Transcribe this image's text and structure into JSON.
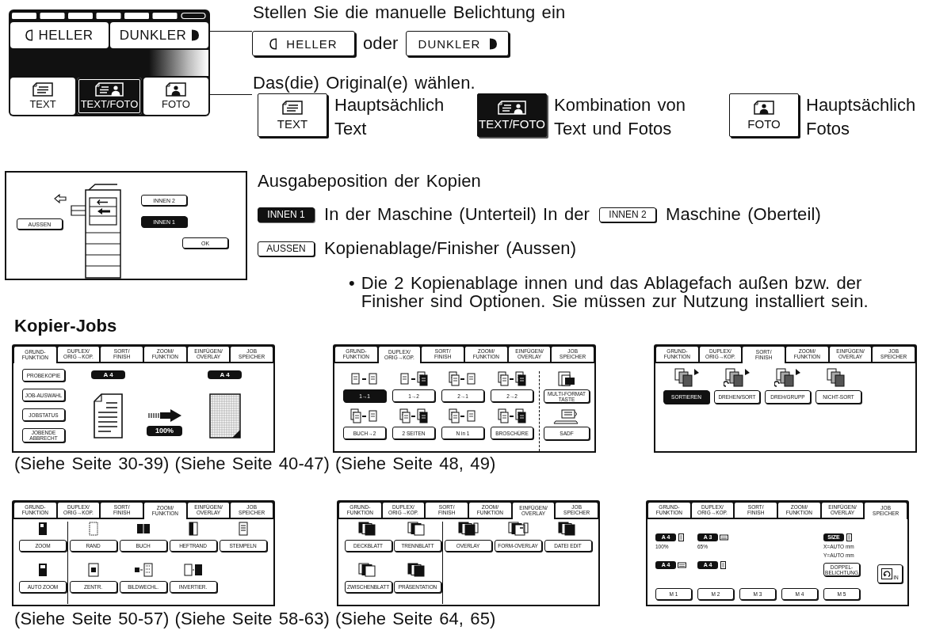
{
  "exposure_panel": {
    "exposure_buttons": [
      {
        "label": "HELLER",
        "kind": "lighter"
      },
      {
        "label": "DUNKLER",
        "kind": "darker"
      }
    ],
    "original_buttons": [
      {
        "label": "TEXT",
        "kind": "text",
        "selected": false
      },
      {
        "label": "TEXT/FOTO",
        "kind": "text_photo",
        "selected": true
      },
      {
        "label": "FOTO",
        "kind": "photo",
        "selected": false
      }
    ]
  },
  "exposure_help": {
    "heading": "Stellen Sie die manuelle Belichtung ein",
    "buttons": [
      {
        "label": "HELLER",
        "kind": "lighter"
      },
      {
        "label": "DUNKLER",
        "kind": "darker"
      }
    ],
    "conjunction": "oder"
  },
  "original_help": {
    "heading": "Das(die) Original(e) wählen.",
    "options": [
      {
        "label": "TEXT",
        "kind": "text",
        "selected": false,
        "description": "Hauptsächlich\nText"
      },
      {
        "label": "TEXT/FOTO",
        "kind": "text_photo",
        "selected": true,
        "description": "Kombination von\nText und Fotos"
      },
      {
        "label": "FOTO",
        "kind": "photo",
        "selected": false,
        "description": "Hauptsächlich\nFotos"
      }
    ]
  },
  "output_panel": {
    "trays": [
      {
        "label": "AUSSEN",
        "kind": "outer",
        "selected": false
      },
      {
        "label": "INNEN 2",
        "kind": "inner",
        "selected": false
      },
      {
        "label": "INNEN 1",
        "kind": "inner",
        "selected": true
      }
    ],
    "ok_button": "OK"
  },
  "output_help": {
    "heading": "Ausgabeposition der Kopien",
    "rows": [
      {
        "button": {
          "label": "INNEN 1",
          "selected": true
        },
        "text": "In der Maschine (Unterteil) In der",
        "inline_button": {
          "label": "INNEN 2",
          "selected": false
        },
        "text_after": "Maschine (Oberteil)"
      },
      {
        "button": {
          "label": "AUSSEN",
          "selected": false
        },
        "text": "Kopienablage/Finisher (Aussen)"
      }
    ],
    "bullet": "•",
    "note": "Die 2 Kopienablage innen und das Ablagefach außen bzw. der\nFinisher sind Optionen. Sie müssen zur Nutzung installiert sein."
  },
  "section_title": "Kopier-Jobs",
  "job_rows": [
    {
      "screens": [
        {
          "kind": "basic",
          "tabs": [
            {
              "label": "GRUND-\nFUNKTION",
              "selected": true
            },
            {
              "label": "DUPLEX/\nORIG→KOP.",
              "selected": false
            },
            {
              "label": "SORT/\nFINISH",
              "selected": false
            },
            {
              "label": "ZOOM/\nFUNKTION",
              "selected": false
            },
            {
              "label": "EINFÜGEN/\nOVERLAY",
              "selected": false
            },
            {
              "label": "JOB\nSPEICHER",
              "selected": false
            }
          ],
          "side_buttons": [
            "PROBEKOPIE",
            "JOB-AUSWAHL",
            "JOBSTATUS",
            "JOBENDE\nABBRECHT"
          ],
          "original_size": "A 4",
          "copy_size": "A 4",
          "ratio": "100%"
        },
        {
          "kind": "duplex",
          "tabs": [
            {
              "label": "GRUND-\nFUNKTION",
              "selected": false
            },
            {
              "label": "DUPLEX/\nORIG→KOP.",
              "selected": true
            },
            {
              "label": "SORT/\nFINISH",
              "selected": false
            },
            {
              "label": "ZOOM/\nFUNKTION",
              "selected": false
            },
            {
              "label": "EINFÜGEN/\nOVERLAY",
              "selected": false
            },
            {
              "label": "JOB\nSPEICHER",
              "selected": false
            }
          ],
          "rows": [
            {
              "buttons": [
                {
                  "label": "1→1",
                  "selected": true
                },
                {
                  "label": "1→2",
                  "selected": false
                },
                {
                  "label": "2→1",
                  "selected": false
                },
                {
                  "label": "2→2",
                  "selected": false
                }
              ]
            },
            {
              "buttons": [
                {
                  "label": "BUCH→2",
                  "selected": false
                },
                {
                  "label": "2 SEITEN",
                  "selected": false
                },
                {
                  "label": "N in 1",
                  "selected": false
                },
                {
                  "label": "BROSCHÜRE",
                  "selected": false
                }
              ]
            }
          ],
          "extras": [
            "MULTI-FORMAT\nTASTE",
            "SADF"
          ]
        },
        {
          "kind": "sort",
          "tabs": [
            {
              "label": "GRUND-\nFUNKTION",
              "selected": false
            },
            {
              "label": "DUPLEX/\nORIG→KOP.",
              "selected": false
            },
            {
              "label": "SORT/\nFINISH",
              "selected": true
            },
            {
              "label": "ZOOM/\nFUNKTION",
              "selected": false
            },
            {
              "label": "EINFÜGEN/\nOVERLAY",
              "selected": false
            },
            {
              "label": "JOB\nSPEICHER",
              "selected": false
            }
          ],
          "options": [
            {
              "label": "SORTIEREN",
              "selected": true
            },
            {
              "label": "DREHEN/SORT",
              "selected": false
            },
            {
              "label": "DREH/GRUPP",
              "selected": false
            },
            {
              "label": "NICHT-SORT",
              "selected": false
            }
          ]
        }
      ],
      "page_refs": [
        "(Siehe Seite 30-39)",
        "(Siehe Seite 40-47)",
        "(Siehe Seite 48, 49)"
      ]
    },
    {
      "screens": [
        {
          "kind": "image_edit",
          "tabs": [
            {
              "label": "GRUND-\nFUNKTION",
              "selected": false
            },
            {
              "label": "DUPLEX/\nORIG→KOP.",
              "selected": false
            },
            {
              "label": "SORT/\nFINISH",
              "selected": false
            },
            {
              "label": "ZOOM/\nFUNKTION",
              "selected": true
            },
            {
              "label": "EINFÜGEN/\nOVERLAY",
              "selected": false
            },
            {
              "label": "JOB\nSPEICHER",
              "selected": false
            }
          ],
          "rows": [
            [
              "ZOOM",
              "RAND",
              "BUCH",
              "HEFTRAND",
              "STEMPELN"
            ],
            [
              "AUTO ZOOM",
              "ZENTR.",
              "BILDWECHL.",
              "INVERTIER."
            ]
          ]
        },
        {
          "kind": "insert",
          "tabs": [
            {
              "label": "GRUND-\nFUNKTION",
              "selected": false
            },
            {
              "label": "DUPLEX/\nORIG→KOP.",
              "selected": false
            },
            {
              "label": "SORT/\nFINISH",
              "selected": false
            },
            {
              "label": "ZOOM/\nFUNKTION",
              "selected": false
            },
            {
              "label": "EINFÜGEN/\nOVERLAY",
              "selected": true
            },
            {
              "label": "JOB\nSPEICHER",
              "selected": false
            }
          ],
          "rows": [
            [
              "DECKBLATT",
              "TRENNBLATT",
              "OVERLAY",
              "FORM-OVERLAY",
              "DATEI EDIT"
            ],
            [
              "ZWISCHENBLATT",
              "PRÄSENTATION"
            ]
          ]
        },
        {
          "kind": "memory",
          "tabs": [
            {
              "label": "GRUND-\nFUNKTION",
              "selected": false
            },
            {
              "label": "DUPLEX/\nORIG→KOP.",
              "selected": false
            },
            {
              "label": "SORT/\nFINISH",
              "selected": false
            },
            {
              "label": "ZOOM/\nFUNKTION",
              "selected": false
            },
            {
              "label": "EINFÜGEN/\nOVERLAY",
              "selected": false
            },
            {
              "label": "JOB\nSPEICHER",
              "selected": true
            }
          ],
          "slots": [
            {
              "kind": "copy",
              "label": "M 1",
              "original": "A 4",
              "ratio": "100%",
              "copy": "A 4"
            },
            {
              "kind": "copy",
              "label": "M 2",
              "original": "A 3",
              "ratio": "65%",
              "copy": "A 4"
            },
            {
              "kind": "empty",
              "label": "M 3"
            },
            {
              "kind": "empty",
              "label": "M 4"
            },
            {
              "kind": "size",
              "label": "M 5",
              "badge": "SIZE",
              "lines": [
                "X=AUTO mm",
                "Y=AUTO mm"
              ],
              "option": "DOPPEL-\nBELICHTUNG"
            }
          ],
          "recall": "IN"
        }
      ],
      "page_refs": [
        "(Siehe Seite 50-57)",
        "(Siehe Seite 58-63)",
        "(Siehe Seite 64, 65)"
      ]
    }
  ]
}
